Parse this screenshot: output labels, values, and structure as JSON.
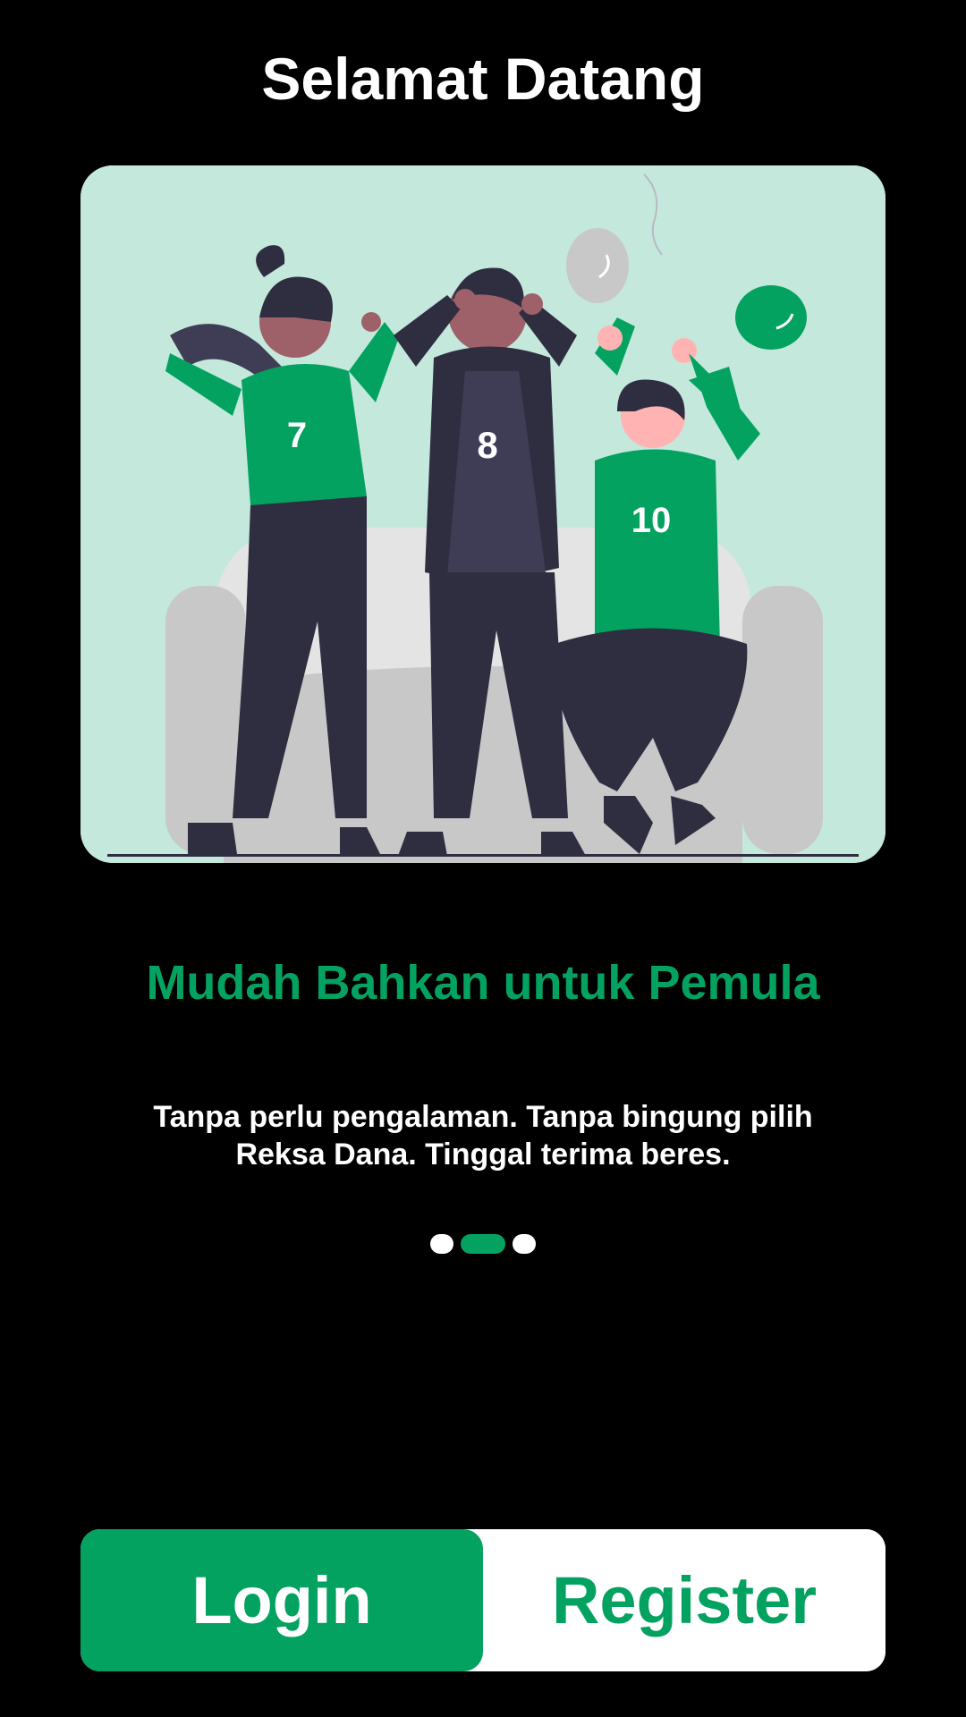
{
  "header": {
    "title": "Selamat Datang"
  },
  "illustration": {
    "jersey_numbers": [
      "7",
      "8",
      "10"
    ]
  },
  "onboarding": {
    "subtitle": "Mudah Bahkan untuk Pemula",
    "description": "Tanpa perlu pengalaman. Tanpa bingung pilih Reksa Dana. Tinggal terima beres.",
    "page_count": 3,
    "active_page": 2
  },
  "actions": {
    "login_label": "Login",
    "register_label": "Register"
  },
  "colors": {
    "accent": "#04a261",
    "background": "#000000",
    "illustration_bg": "#c4e8dc"
  }
}
